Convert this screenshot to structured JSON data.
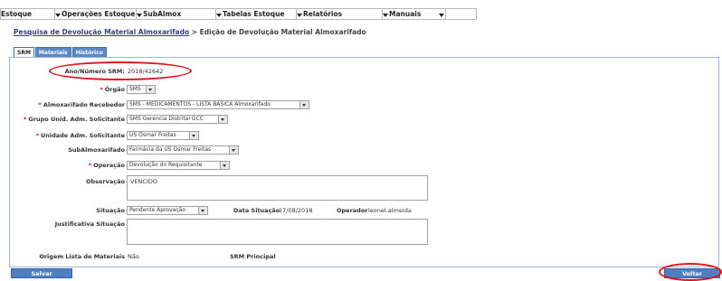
{
  "menu": [
    "Estoque",
    "Operações Estoque",
    "SubAlmox",
    "Tabelas Estoque",
    "Relatórios",
    "Manuais"
  ],
  "breadcrumb": {
    "link": "Pesquisa de Devolução Material Almoxarifado",
    "current": "> Edição de Devolução Material Almoxarifado"
  },
  "tabs": [
    "SRM",
    "Materiais",
    "Histórico"
  ],
  "fields": {
    "ano_numero_srm": {
      "label": "Ano/Número SRM:",
      "value": "2018/42642"
    },
    "orgao": {
      "label": "Órgão",
      "value": "SMS"
    },
    "almoxarifado_recebedor": {
      "label": "Almoxarifado Recebedor",
      "value": "SMS - MEDICAMENTOS - LISTA BÁSICA Almoxarifado"
    },
    "grupo_unid_adm": {
      "label": "Grupo Unid. Adm. Solicitante",
      "value": "SMS Gerencia Distrital GCC"
    },
    "unidade_adm": {
      "label": "Unidade Adm. Solicitante",
      "value": "US Osmar Freitas"
    },
    "subalmoxarifado": {
      "label": "SubAlmoxarifado",
      "value": "Farmácia da US Osmar Freitas"
    },
    "operacao": {
      "label": "Operação",
      "value": "Devolução do Requisitante"
    },
    "observacao": {
      "label": "Observação",
      "value": "VENCIDO"
    },
    "situacao": {
      "label": "Situação",
      "value": "Pendente Aprovação"
    },
    "data_situacao": {
      "label": "Data Situação",
      "value": "17/08/2018"
    },
    "operador": {
      "label": "Operador",
      "value": "leonel.almeida"
    },
    "justificativa": {
      "label": "Justificativa Situação",
      "value": ""
    },
    "origem_lista": {
      "label": "Origem Lista de Materiais",
      "value": "Não"
    },
    "srm_principal": {
      "label": "SRM Principal",
      "value": ""
    }
  },
  "buttons": {
    "salvar": "Salvar",
    "voltar": "Voltar"
  },
  "colors": {
    "accent": "#4f7fc2",
    "highlight_ellipse": "#e0141a",
    "required": "#d00000"
  }
}
